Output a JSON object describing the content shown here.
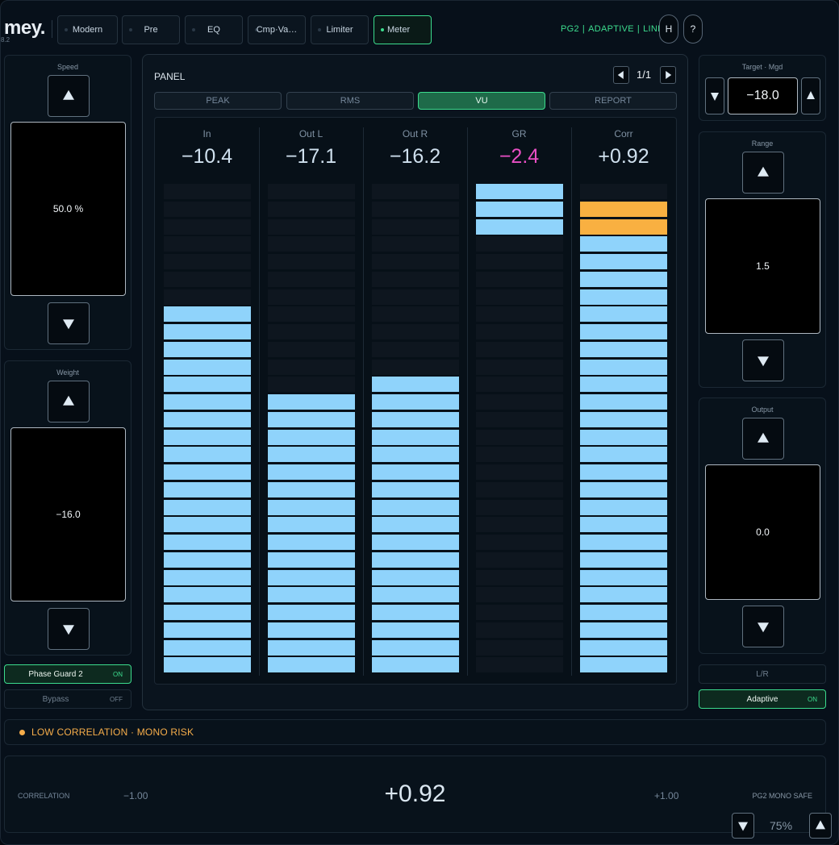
{
  "app": {
    "logo": "mey.",
    "version": "8.2"
  },
  "tabs": [
    {
      "label": "Modern",
      "active": false
    },
    {
      "label": "Pre",
      "active": false
    },
    {
      "label": "EQ",
      "active": false
    },
    {
      "label": "Cmp·Va…",
      "active": false
    },
    {
      "label": "Limiter",
      "active": false
    },
    {
      "label": "Meter",
      "active": true
    }
  ],
  "status": {
    "items": [
      "PG2",
      "ADAPTIVE",
      "LINK"
    ],
    "separator": "|"
  },
  "header_buttons": {
    "h_label": "H",
    "help_label": "?"
  },
  "left": {
    "speed": {
      "title": "Speed",
      "value": "50.0 %"
    },
    "weight": {
      "title": "Weight",
      "value": "−16.0"
    },
    "phase_guard": {
      "label": "Phase Guard 2",
      "state": "ON"
    },
    "bypass": {
      "label": "Bypass",
      "state": "OFF"
    }
  },
  "right": {
    "target": {
      "title": "Target · Mgd",
      "value": "−18.0"
    },
    "range": {
      "title": "Range",
      "value": "1.5"
    },
    "output": {
      "title": "Output",
      "value": "0.0"
    },
    "lr": {
      "label": "L/R"
    },
    "adaptive": {
      "label": "Adaptive",
      "state": "ON"
    }
  },
  "center": {
    "title": "PANEL",
    "page": "1/1",
    "modes": [
      {
        "label": "PEAK",
        "active": false
      },
      {
        "label": "RMS",
        "active": false
      },
      {
        "label": "VU",
        "active": true
      },
      {
        "label": "REPORT",
        "active": false
      }
    ],
    "segments_per_meter": 28,
    "meters": [
      {
        "label": "In",
        "value": "−10.4",
        "value_color": "#cfe0ee",
        "fill": "bottom",
        "lit": 21,
        "amber": 0
      },
      {
        "label": "Out L",
        "value": "−17.1",
        "value_color": "#cfe0ee",
        "fill": "bottom",
        "lit": 16,
        "amber": 0
      },
      {
        "label": "Out R",
        "value": "−16.2",
        "value_color": "#cfe0ee",
        "fill": "bottom",
        "lit": 17,
        "amber": 0
      },
      {
        "label": "GR",
        "value": "−2.4",
        "value_color": "#e84fc4",
        "fill": "top",
        "lit": 3,
        "amber": 0
      },
      {
        "label": "Corr",
        "value": "+0.92",
        "value_color": "#cfe0ee",
        "fill": "bottom",
        "lit": 27,
        "amber": 2
      }
    ]
  },
  "colors": {
    "accent": "#3cdc8e",
    "segment_lit": "#8fd3fb",
    "segment_amber": "#f9b041",
    "segment_off": "#0e161f",
    "warning": "#f6ad4a",
    "gr_value": "#e84fc4"
  },
  "warning": {
    "text": "LOW CORRELATION · MONO RISK"
  },
  "correlation": {
    "label": "CORRELATION",
    "min": "−1.00",
    "value": "+0.92",
    "max": "+1.00",
    "status": "PG2 MONO SAFE"
  },
  "zoom": {
    "value": "75%"
  }
}
